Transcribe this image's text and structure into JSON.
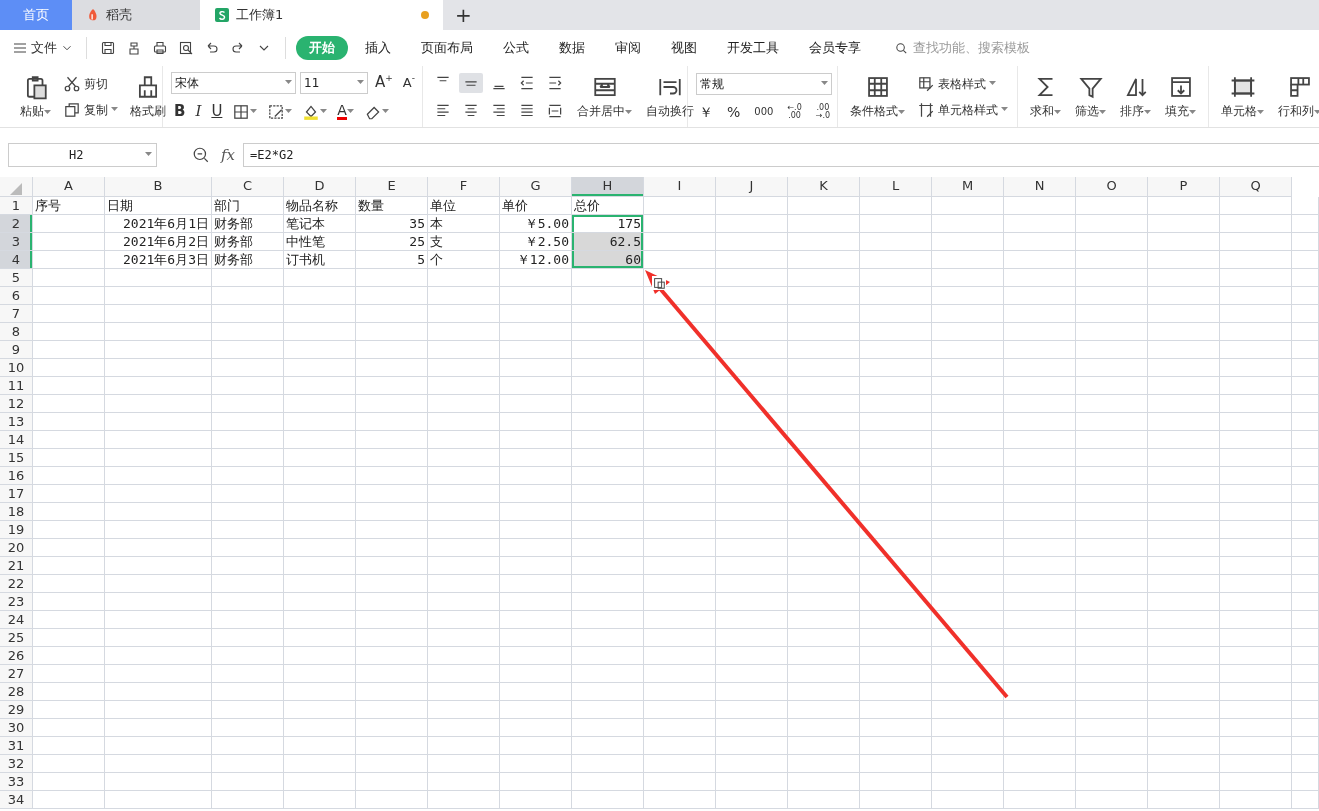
{
  "app_tabs": [
    {
      "label": "首页",
      "kind": "home",
      "selected": false,
      "unsaved": false
    },
    {
      "label": "稻壳",
      "kind": "app",
      "selected": false,
      "unsaved": false
    },
    {
      "label": "工作簿1",
      "kind": "sheet",
      "selected": true,
      "unsaved": true
    }
  ],
  "new_tab": "+",
  "file_menu": "文件",
  "menu_tabs": [
    {
      "label": "开始",
      "selected": true
    },
    {
      "label": "插入",
      "selected": false
    },
    {
      "label": "页面布局",
      "selected": false
    },
    {
      "label": "公式",
      "selected": false
    },
    {
      "label": "数据",
      "selected": false
    },
    {
      "label": "审阅",
      "selected": false
    },
    {
      "label": "视图",
      "selected": false
    },
    {
      "label": "开发工具",
      "selected": false
    },
    {
      "label": "会员专享",
      "selected": false
    }
  ],
  "search": {
    "placeholder": "查找功能、搜索模板"
  },
  "ribbon": {
    "paste": "粘贴",
    "cut": "剪切",
    "copy": "复制",
    "format_painter": "格式刷",
    "font_name": "宋体",
    "font_size": "11",
    "grow_font": "A",
    "grow_font_mark": "+",
    "shrink_font": "A",
    "shrink_font_mark": "-",
    "bold": "B",
    "italic": "I",
    "underline": "U",
    "font_color": "A",
    "align_top": [
      {
        "selected": false
      },
      {
        "selected": true
      },
      {
        "selected": false
      },
      {
        "selected": false
      },
      {
        "selected": false
      }
    ],
    "merge": "合并居中",
    "wrap": "自动换行",
    "number_format": "常规",
    "number_buttons": [
      "￥",
      "%",
      "000"
    ],
    "decimal_increase": [
      "←.0",
      ".00"
    ],
    "decimal_decrease": [
      ".00",
      "→.0"
    ],
    "conditional_format": "条件格式",
    "table_style": "表格样式",
    "cell_style": "单元格样式",
    "big_buttons": [
      {
        "label": "求和",
        "kind": "sum"
      },
      {
        "label": "筛选",
        "kind": "filter"
      },
      {
        "label": "排序",
        "kind": "sort"
      },
      {
        "label": "填充",
        "kind": "fill"
      },
      {
        "label": "单元格",
        "kind": "cell"
      },
      {
        "label": "行和列",
        "kind": "rowcol"
      }
    ]
  },
  "formula_bar": {
    "name_box": "H2",
    "fx": "fx",
    "formula": "=E2*G2"
  },
  "columns": [
    {
      "label": "A",
      "selected": false
    },
    {
      "label": "B",
      "selected": false
    },
    {
      "label": "C",
      "selected": false
    },
    {
      "label": "D",
      "selected": false
    },
    {
      "label": "E",
      "selected": false
    },
    {
      "label": "F",
      "selected": false
    },
    {
      "label": "G",
      "selected": false
    },
    {
      "label": "H",
      "selected": true
    },
    {
      "label": "I",
      "selected": false
    },
    {
      "label": "J",
      "selected": false
    },
    {
      "label": "K",
      "selected": false
    },
    {
      "label": "L",
      "selected": false
    },
    {
      "label": "M",
      "selected": false
    },
    {
      "label": "N",
      "selected": false
    },
    {
      "label": "O",
      "selected": false
    },
    {
      "label": "P",
      "selected": false
    },
    {
      "label": "Q",
      "selected": false
    }
  ],
  "rows": [
    {
      "label": "1",
      "selected": false,
      "cells": [
        {
          "text": "序号",
          "kind": "text",
          "selected": false
        },
        {
          "text": "日期",
          "kind": "text",
          "selected": false
        },
        {
          "text": "部门",
          "kind": "text",
          "selected": false
        },
        {
          "text": "物品名称",
          "kind": "text",
          "selected": false
        },
        {
          "text": "数量",
          "kind": "text",
          "selected": false
        },
        {
          "text": "单位",
          "kind": "text",
          "selected": false
        },
        {
          "text": "单价",
          "kind": "text",
          "selected": false
        },
        {
          "text": "总价",
          "kind": "text",
          "selected": false
        }
      ]
    },
    {
      "label": "2",
      "selected": true,
      "cells": [
        {
          "text": "",
          "kind": "text",
          "selected": false
        },
        {
          "text": "2021年6月1日",
          "kind": "number",
          "selected": false
        },
        {
          "text": "财务部",
          "kind": "text",
          "selected": false
        },
        {
          "text": "笔记本",
          "kind": "text",
          "selected": false
        },
        {
          "text": "35",
          "kind": "number",
          "selected": false
        },
        {
          "text": "本",
          "kind": "text",
          "selected": false
        },
        {
          "text": "￥5.00",
          "kind": "number",
          "selected": false
        },
        {
          "text": "175",
          "kind": "number",
          "selected": true
        }
      ]
    },
    {
      "label": "3",
      "selected": true,
      "cells": [
        {
          "text": "",
          "kind": "text",
          "selected": false
        },
        {
          "text": "2021年6月2日",
          "kind": "number",
          "selected": false
        },
        {
          "text": "财务部",
          "kind": "text",
          "selected": false
        },
        {
          "text": "中性笔",
          "kind": "text",
          "selected": false
        },
        {
          "text": "25",
          "kind": "number",
          "selected": false
        },
        {
          "text": "支",
          "kind": "text",
          "selected": false
        },
        {
          "text": "￥2.50",
          "kind": "number",
          "selected": false
        },
        {
          "text": "62.5",
          "kind": "number",
          "selected": true
        }
      ]
    },
    {
      "label": "4",
      "selected": true,
      "cells": [
        {
          "text": "",
          "kind": "text",
          "selected": false
        },
        {
          "text": "2021年6月3日",
          "kind": "number",
          "selected": false
        },
        {
          "text": "财务部",
          "kind": "text",
          "selected": false
        },
        {
          "text": "订书机",
          "kind": "text",
          "selected": false
        },
        {
          "text": "5",
          "kind": "number",
          "selected": false
        },
        {
          "text": "个",
          "kind": "text",
          "selected": false
        },
        {
          "text": "￥12.00",
          "kind": "number",
          "selected": false
        },
        {
          "text": "60",
          "kind": "number",
          "selected": true
        }
      ]
    },
    {
      "label": "5",
      "selected": false
    },
    {
      "label": "6",
      "selected": false
    },
    {
      "label": "7",
      "selected": false
    },
    {
      "label": "8",
      "selected": false
    },
    {
      "label": "9",
      "selected": false
    },
    {
      "label": "10",
      "selected": false
    },
    {
      "label": "11",
      "selected": false
    },
    {
      "label": "12",
      "selected": false
    },
    {
      "label": "13",
      "selected": false
    },
    {
      "label": "14",
      "selected": false
    },
    {
      "label": "15",
      "selected": false
    },
    {
      "label": "16",
      "selected": false
    },
    {
      "label": "17",
      "selected": false
    },
    {
      "label": "18",
      "selected": false
    },
    {
      "label": "19",
      "selected": false
    },
    {
      "label": "20",
      "selected": false
    },
    {
      "label": "21",
      "selected": false
    },
    {
      "label": "22",
      "selected": false
    },
    {
      "label": "23",
      "selected": false
    },
    {
      "label": "24",
      "selected": false
    },
    {
      "label": "25",
      "selected": false
    },
    {
      "label": "26",
      "selected": false
    },
    {
      "label": "27",
      "selected": false
    },
    {
      "label": "28",
      "selected": false
    },
    {
      "label": "29",
      "selected": false
    },
    {
      "label": "30",
      "selected": false
    },
    {
      "label": "31",
      "selected": false
    },
    {
      "label": "32",
      "selected": false
    },
    {
      "label": "33",
      "selected": false
    },
    {
      "label": "34",
      "selected": false
    }
  ]
}
